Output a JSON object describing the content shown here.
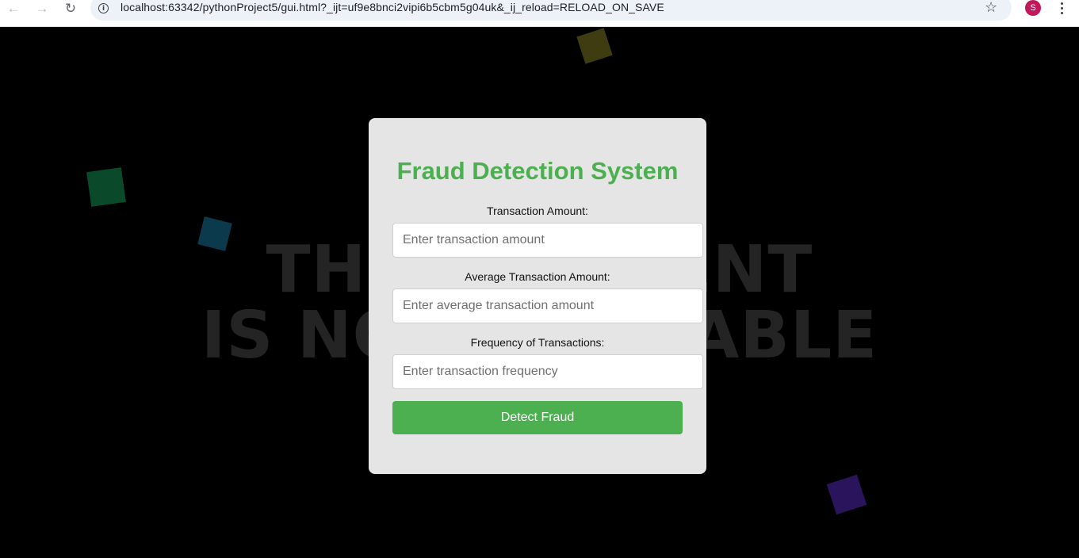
{
  "browser": {
    "url": "localhost:63342/pythonProject5/gui.html?_ijt=uf9e8bnci2vipi6b5cbm5g04uk&_ij_reload=RELOAD_ON_SAVE",
    "back_icon": "←",
    "forward_icon": "→",
    "reload_icon": "↻",
    "info_icon": "i",
    "star_icon": "☆",
    "avatar_initial": "S",
    "avatar_color": "#c2185b"
  },
  "background": {
    "line1": "THIS CONTENT",
    "line2": "IS NOT AVAILABLE"
  },
  "form": {
    "title": "Fraud Detection System",
    "title_color": "#4caf50",
    "fields": [
      {
        "label": "Transaction Amount:",
        "placeholder": "Enter transaction amount"
      },
      {
        "label": "Average Transaction Amount:",
        "placeholder": "Enter average transaction amount"
      },
      {
        "label": "Frequency of Transactions:",
        "placeholder": "Enter transaction frequency"
      }
    ],
    "submit_label": "Detect Fraud",
    "button_color": "#4caf50"
  }
}
